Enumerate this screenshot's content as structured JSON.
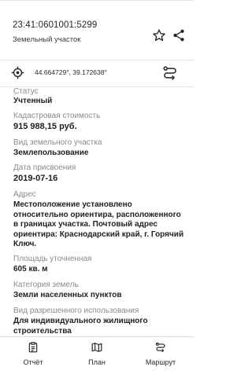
{
  "header": {
    "cadastral_number": "23:41:0601001:5299",
    "object_type": "Земельный участок"
  },
  "coordinates": {
    "text": "44.664729°, 39.172638°"
  },
  "fields": [
    {
      "label": "Статус",
      "value": "Учтенный"
    },
    {
      "label": "Кадастровая стоимость",
      "value": "915 988,15 руб."
    },
    {
      "label": "Вид земельного участка",
      "value": "Землепользование"
    },
    {
      "label": "Дата присвоения",
      "value": "2019-07-16"
    },
    {
      "label": "Адрес",
      "value": "Местоположение установлено относительно ориентира, расположенного в границах участка. Почтовый адрес ориентира: Краснодарский край, г. Горячий Ключ."
    },
    {
      "label": "Площадь уточненная",
      "value": "605 кв. м"
    },
    {
      "label": "Категория земель",
      "value": "Земли населенных пунктов"
    },
    {
      "label": "Вид разрешенного использования",
      "value": "Для индивидуального жилищного строительства"
    }
  ],
  "bottom_nav": {
    "tabs": [
      {
        "label": "Отчёт",
        "icon": "report-icon"
      },
      {
        "label": "План",
        "icon": "map-icon"
      },
      {
        "label": "Маршрут",
        "icon": "route-icon"
      }
    ]
  }
}
